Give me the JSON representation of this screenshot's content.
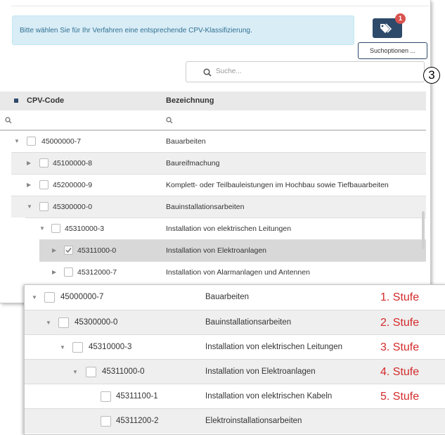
{
  "info": {
    "text": "Bitte wählen Sie für Ihr Verfahren eine entsprechende CPV-Klassifizierung."
  },
  "tag_badge": "1",
  "suchoptionen_label": "Suchoptionen ...",
  "search": {
    "placeholder": "Suche..."
  },
  "annotation": "3",
  "table": {
    "col_code": "CPV-Code",
    "col_name": "Bezeichnung",
    "rows": [
      {
        "code": "45000000-7",
        "name": "Bauarbeiten"
      },
      {
        "code": "45100000-8",
        "name": "Baureifmachung"
      },
      {
        "code": "45200000-9",
        "name": "Komplett- oder Teilbauleistungen im Hochbau sowie Tiefbauarbeiten"
      },
      {
        "code": "45300000-0",
        "name": "Bauinstallationsarbeiten"
      },
      {
        "code": "45310000-3",
        "name": "Installation von elektrischen Leitungen"
      },
      {
        "code": "45311000-0",
        "name": "Installation von Elektroanlagen"
      },
      {
        "code": "45312000-7",
        "name": "Installation von Alarmanlagen und Antennen"
      }
    ]
  },
  "zoom": {
    "rows": [
      {
        "code": "45000000-7",
        "name": "Bauarbeiten",
        "stufe": "1. Stufe"
      },
      {
        "code": "45300000-0",
        "name": "Bauinstallationsarbeiten",
        "stufe": "2. Stufe"
      },
      {
        "code": "45310000-3",
        "name": "Installation von elektrischen Leitungen",
        "stufe": "3. Stufe"
      },
      {
        "code": "45311000-0",
        "name": "Installation von Elektroanlagen",
        "stufe": "4. Stufe"
      },
      {
        "code": "45311100-1",
        "name": "Installation von elektrischen Kabeln",
        "stufe": "5. Stufe"
      },
      {
        "code": "45311200-2",
        "name": "Elektroinstallationsarbeiten",
        "stufe": ""
      }
    ]
  },
  "colors": {
    "accent": "#2e4a6b",
    "info_bg": "#d9edf7",
    "badge": "#d9534f",
    "stufe": "#d42a2a"
  }
}
